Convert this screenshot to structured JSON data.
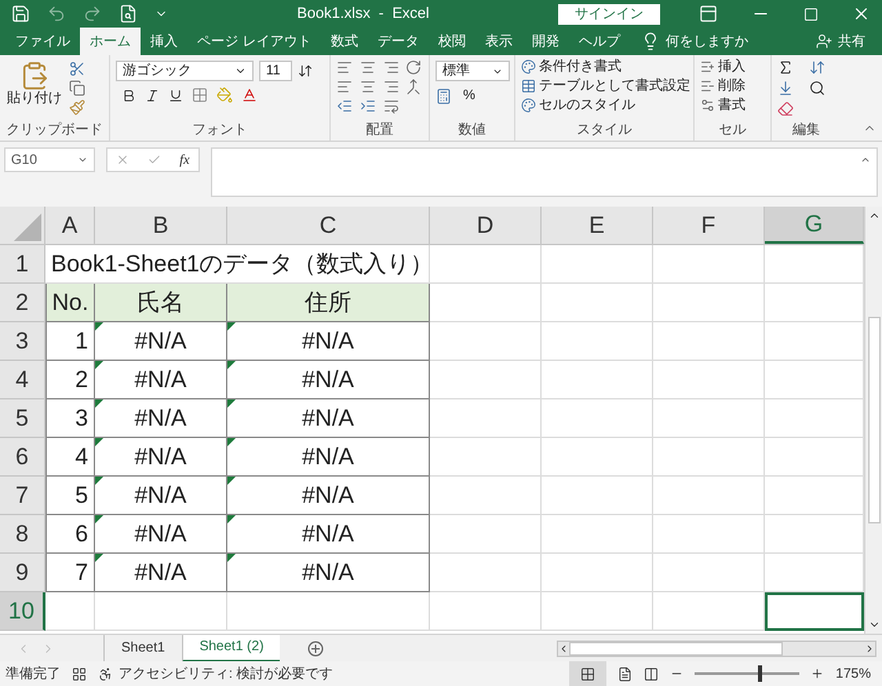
{
  "title_bar": {
    "title": "Book1.xlsx  -  Excel",
    "sign_in": "サインイン"
  },
  "menu": {
    "tabs": [
      {
        "label": "ファイル",
        "selected": false
      },
      {
        "label": "ホーム",
        "selected": true
      },
      {
        "label": "挿入",
        "selected": false
      },
      {
        "label": "ページ レイアウト",
        "selected": false
      },
      {
        "label": "数式",
        "selected": false
      },
      {
        "label": "データ",
        "selected": false
      },
      {
        "label": "校閲",
        "selected": false
      },
      {
        "label": "表示",
        "selected": false
      },
      {
        "label": "開発",
        "selected": false
      },
      {
        "label": "ヘルプ",
        "selected": false
      }
    ],
    "tell_me": "何をしますか",
    "share": "共有"
  },
  "ribbon": {
    "clipboard": {
      "paste": "貼り付け",
      "label": "クリップボード"
    },
    "font": {
      "font_name": "游ゴシック",
      "font_size": "11",
      "label": "フォント"
    },
    "alignment": {
      "label": "配置"
    },
    "number": {
      "format": "標準",
      "percent": "%",
      "label": "数値"
    },
    "styles": {
      "items": [
        "条件付き書式",
        "テーブルとして書式設定",
        "セルのスタイル"
      ],
      "label": "スタイル"
    },
    "cells": {
      "items": [
        "挿入",
        "削除",
        "書式"
      ],
      "label": "セル"
    },
    "editing": {
      "label": "編集"
    }
  },
  "formula_bar": {
    "name_box": "G10",
    "fx": "fx"
  },
  "grid": {
    "columns": [
      {
        "label": "A",
        "selected": false
      },
      {
        "label": "B",
        "selected": false
      },
      {
        "label": "C",
        "selected": false
      },
      {
        "label": "D",
        "selected": false
      },
      {
        "label": "E",
        "selected": false
      },
      {
        "label": "F",
        "selected": false
      },
      {
        "label": "G",
        "selected": true
      }
    ],
    "rows": [
      {
        "label": "1",
        "selected": false,
        "cells": [
          {
            "kind": "title",
            "text": "Book1-Sheet1のデータ（数式入り）"
          }
        ]
      },
      {
        "label": "2",
        "selected": false,
        "cells": [
          {
            "kind": "header",
            "text": "No."
          },
          {
            "kind": "header",
            "text": "氏名"
          },
          {
            "kind": "header",
            "text": "住所"
          }
        ]
      },
      {
        "label": "3",
        "selected": false,
        "cells": [
          {
            "kind": "number",
            "text": "1"
          },
          {
            "kind": "error",
            "text": "#N/A"
          },
          {
            "kind": "error",
            "text": "#N/A"
          }
        ]
      },
      {
        "label": "4",
        "selected": false,
        "cells": [
          {
            "kind": "number",
            "text": "2"
          },
          {
            "kind": "error",
            "text": "#N/A"
          },
          {
            "kind": "error",
            "text": "#N/A"
          }
        ]
      },
      {
        "label": "5",
        "selected": false,
        "cells": [
          {
            "kind": "number",
            "text": "3"
          },
          {
            "kind": "error",
            "text": "#N/A"
          },
          {
            "kind": "error",
            "text": "#N/A"
          }
        ]
      },
      {
        "label": "6",
        "selected": false,
        "cells": [
          {
            "kind": "number",
            "text": "4"
          },
          {
            "kind": "error",
            "text": "#N/A"
          },
          {
            "kind": "error",
            "text": "#N/A"
          }
        ]
      },
      {
        "label": "7",
        "selected": false,
        "cells": [
          {
            "kind": "number",
            "text": "5"
          },
          {
            "kind": "error",
            "text": "#N/A"
          },
          {
            "kind": "error",
            "text": "#N/A"
          }
        ]
      },
      {
        "label": "8",
        "selected": false,
        "cells": [
          {
            "kind": "number",
            "text": "6"
          },
          {
            "kind": "error",
            "text": "#N/A"
          },
          {
            "kind": "error",
            "text": "#N/A"
          }
        ]
      },
      {
        "label": "9",
        "selected": false,
        "cells": [
          {
            "kind": "number",
            "text": "7"
          },
          {
            "kind": "error",
            "text": "#N/A"
          },
          {
            "kind": "error",
            "text": "#N/A"
          }
        ]
      },
      {
        "label": "10",
        "selected": true,
        "cells": []
      }
    ]
  },
  "sheet_tabs": [
    {
      "label": "Sheet1",
      "selected": false
    },
    {
      "label": "Sheet1 (2)",
      "selected": true
    }
  ],
  "status_bar": {
    "ready": "準備完了",
    "accessibility": "アクセシビリティ: 検討が必要です",
    "zoom": "175%",
    "zoom_slider": {
      "level": 0.6
    }
  }
}
